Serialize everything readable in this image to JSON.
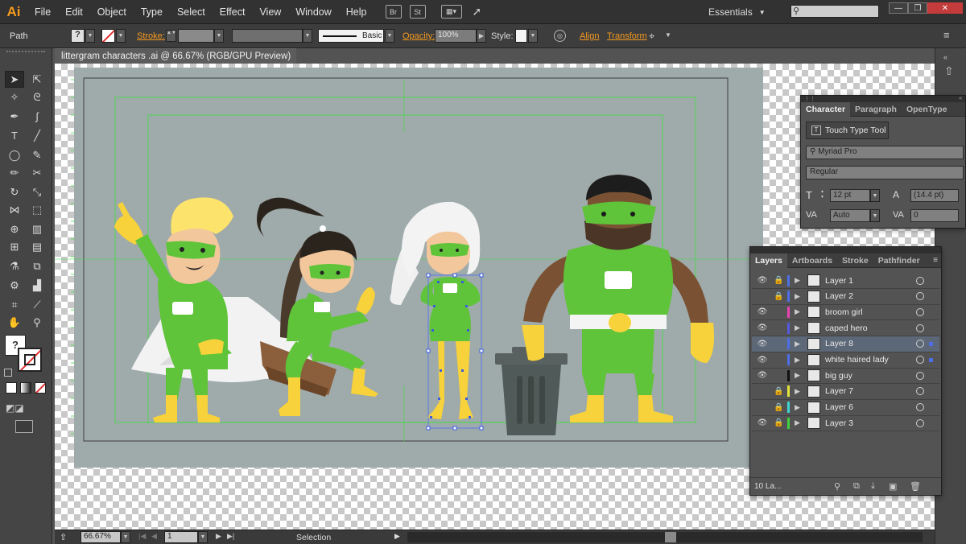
{
  "app": {
    "logo": "Ai"
  },
  "menu": [
    "File",
    "Edit",
    "Object",
    "Type",
    "Select",
    "Effect",
    "View",
    "Window",
    "Help"
  ],
  "menubar_icons": {
    "bridge": "Br",
    "stock": "St"
  },
  "workspace": "Essentials",
  "control": {
    "selection_type": "Path",
    "stroke_label": "Stroke:",
    "brush_label": "Basic",
    "opacity_label": "Opacity:",
    "opacity_value": "100%",
    "style_label": "Style:",
    "align_label": "Align",
    "transform_label": "Transform"
  },
  "document": {
    "tab_title": "littergram characters .ai @ 66.67% (RGB/GPU Preview)",
    "close_icon": "×"
  },
  "status": {
    "zoom": "66.67%",
    "artboard": "1",
    "tool": "Selection"
  },
  "character_panel": {
    "tabs": [
      "Character",
      "Paragraph",
      "OpenType"
    ],
    "touch_type": "Touch Type Tool",
    "font": "Myriad Pro",
    "style": "Regular",
    "size": "12 pt",
    "leading": "(14.4 pt)",
    "kerning": "Auto",
    "tracking": "0"
  },
  "layers_panel": {
    "tabs": [
      "Layers",
      "Artboards",
      "Stroke",
      "Pathfinder"
    ],
    "count": "10 La...",
    "layers": [
      {
        "name": "Layer 1",
        "visible": true,
        "locked": true,
        "color": "#4d6ee6",
        "selected": false
      },
      {
        "name": "Layer 2",
        "visible": false,
        "locked": true,
        "color": "#4d6ee6",
        "selected": false
      },
      {
        "name": "broom girl",
        "visible": true,
        "locked": false,
        "color": "#e843b2",
        "selected": false
      },
      {
        "name": "caped hero",
        "visible": true,
        "locked": false,
        "color": "#5558e0",
        "selected": false
      },
      {
        "name": "Layer 8",
        "visible": true,
        "locked": false,
        "color": "#4d6ee6",
        "selected": true
      },
      {
        "name": "white haired lady",
        "visible": true,
        "locked": false,
        "color": "#4d6ee6",
        "selected": false
      },
      {
        "name": "big guy",
        "visible": true,
        "locked": false,
        "color": "#111111",
        "selected": false
      },
      {
        "name": "Layer 7",
        "visible": false,
        "locked": true,
        "color": "#e3e33d",
        "selected": false
      },
      {
        "name": "Layer 6",
        "visible": false,
        "locked": true,
        "color": "#3ed4d4",
        "selected": false
      },
      {
        "name": "Layer 3",
        "visible": true,
        "locked": true,
        "color": "#3ed43e",
        "selected": false
      }
    ]
  },
  "colors": {
    "accent": "#f49a1f",
    "hero_green": "#5fc43a",
    "skin": "#f3c79c",
    "yellow": "#f7d23a",
    "artboard": "#9faaaa"
  }
}
